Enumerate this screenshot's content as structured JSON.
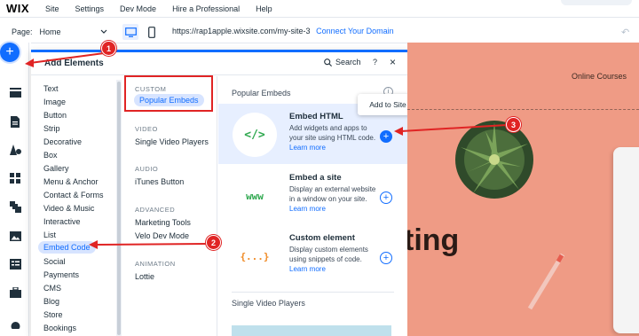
{
  "topbar": {
    "logo": "WIX",
    "menu": [
      "Site",
      "Settings",
      "Dev Mode",
      "Hire a Professional",
      "Help"
    ]
  },
  "pagebar": {
    "page_label": "Page:",
    "page_value": "Home",
    "url": "https://rap1apple.wixsite.com/my-site-3",
    "connect_domain": "Connect Your Domain"
  },
  "panel": {
    "title": "Add Elements",
    "search_label": "Search",
    "help": "?",
    "close": "×",
    "categories": [
      "Text",
      "Image",
      "Button",
      "Strip",
      "Decorative",
      "Box",
      "Gallery",
      "Menu & Anchor",
      "Contact & Forms",
      "Video & Music",
      "Interactive",
      "List",
      "Embed Code",
      "Social",
      "Payments",
      "CMS",
      "Blog",
      "Store",
      "Bookings"
    ],
    "selected_category": "Embed Code",
    "subcategories": {
      "custom_heading": "CUSTOM",
      "custom_item": "Popular Embeds",
      "video_heading": "VIDEO",
      "video_item": "Single Video Players",
      "audio_heading": "AUDIO",
      "audio_item": "iTunes Button",
      "advanced_heading": "ADVANCED",
      "advanced_items": [
        "Marketing Tools",
        "Velo Dev Mode"
      ],
      "animation_heading": "ANIMATION",
      "animation_item": "Lottie"
    },
    "section_title": "Popular Embeds",
    "embeds": [
      {
        "icon": "</>",
        "name": "Embed HTML",
        "desc": "Add widgets and apps to your site using HTML code.",
        "learn": "Learn more"
      },
      {
        "icon": "www",
        "name": "Embed a site",
        "desc": "Display an external website in a window on your site.",
        "learn": "Learn more"
      },
      {
        "icon": "{...}",
        "name": "Custom element",
        "desc": "Display custom elements using snippets of code.",
        "learn": "Learn more"
      }
    ],
    "next_section": "Single Video Players",
    "tooltip": "Add to Site"
  },
  "canvas": {
    "online_courses": "Online Courses",
    "hero_fragment": "ting"
  },
  "callouts": [
    "1",
    "2",
    "3"
  ],
  "colors": {
    "accent": "#116dff",
    "callout": "#e02424",
    "canvas_bg": "#ef9b85"
  }
}
